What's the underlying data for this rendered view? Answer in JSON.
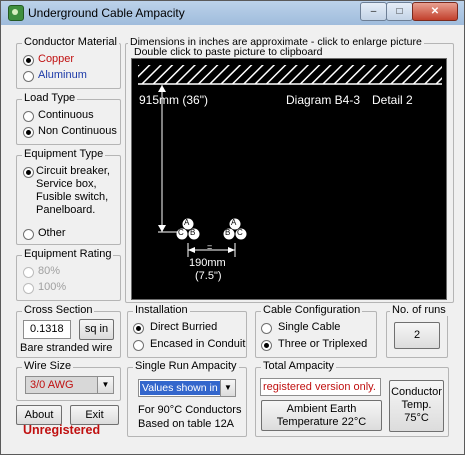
{
  "window": {
    "title": "Underground Cable Ampacity"
  },
  "conductor_material": {
    "legend": "Conductor Material",
    "options": [
      "Copper",
      "Aluminum"
    ],
    "selected": "Copper"
  },
  "load_type": {
    "legend": "Load Type",
    "options": [
      "Continuous",
      "Non Continuous"
    ],
    "selected": "Non Continuous"
  },
  "equipment_type": {
    "legend": "Equipment Type",
    "options": [
      "Circuit breaker,",
      "Service box,",
      "Fusible switch,",
      "Panelboard."
    ],
    "other": "Other",
    "selected": "Circuit breaker"
  },
  "equipment_rating": {
    "legend": "Equipment Rating",
    "options": [
      "80%",
      "100%"
    ]
  },
  "diagram": {
    "note_line1": "Dimensions in inches are approximate - click to enlarge picture",
    "note_line2": "Double click to paste picture to clipboard",
    "depth_label": "915mm (36\")",
    "title": "Diagram B4-3",
    "detail": "Detail 2",
    "spacing_label": "190mm",
    "spacing_inches": "(7.5\")",
    "cable_letters": [
      "A",
      "B",
      "C"
    ],
    "eq": "="
  },
  "cross_section": {
    "legend": "Cross Section",
    "value": "0.1318",
    "unit_button": "sq in",
    "note": "Bare stranded wire"
  },
  "installation": {
    "legend": "Installation",
    "options": [
      "Direct Burried",
      "Encased in Conduit"
    ],
    "selected": "Direct Burried"
  },
  "cable_configuration": {
    "legend": "Cable Configuration",
    "options": [
      "Single Cable",
      "Three or Triplexed"
    ],
    "selected": "Three or Triplexed"
  },
  "runs": {
    "legend": "No. of runs",
    "value": "2"
  },
  "wire_size": {
    "legend": "Wire Size",
    "value": "3/0 AWG"
  },
  "single_run": {
    "legend": "Single Run Ampacity",
    "value": "Values shown in",
    "note_line1": "For 90°C Conductors",
    "note_line2": "Based on table 12A"
  },
  "total": {
    "legend": "Total Ampacity",
    "value": "registered version only.",
    "ambient_line1": "Ambient Earth",
    "ambient_line2": "Temperature 22°C"
  },
  "conductor_temp": {
    "line1": "Conductor",
    "line2": "Temp.",
    "line3": "75°C"
  },
  "buttons": {
    "about": "About",
    "exit": "Exit"
  },
  "status": {
    "unregistered": "Unregistered"
  },
  "colors": {
    "accent_red": "#c01010",
    "accent_blue": "#1c3aa8",
    "select_highlight": "#3366cc"
  }
}
